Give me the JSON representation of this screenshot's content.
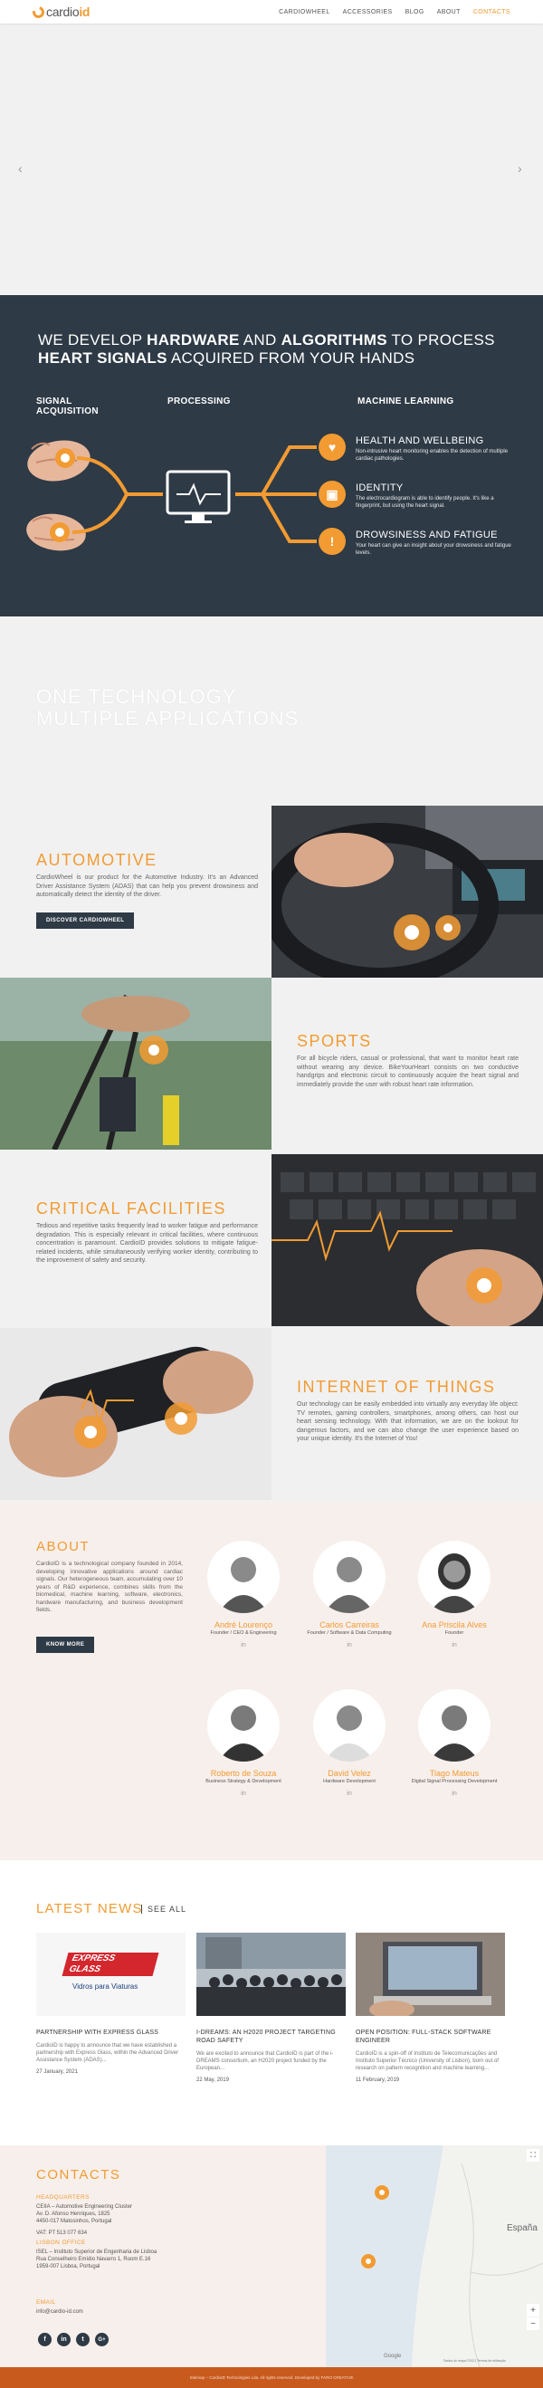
{
  "header": {
    "logo_prefix": "cardio",
    "logo_suffix": "id",
    "nav": [
      {
        "label": "CARDIOWHEEL",
        "active": false
      },
      {
        "label": "ACCESSORIES",
        "active": false
      },
      {
        "label": "BLOG",
        "active": false
      },
      {
        "label": "ABOUT",
        "active": false
      },
      {
        "label": "CONTACTS",
        "active": true
      }
    ]
  },
  "hero": {
    "prev_arrow": "‹",
    "next_arrow": "›"
  },
  "dark": {
    "headline_1": "WE DEVELOP ",
    "headline_2": "HARDWARE",
    "headline_3": " AND ",
    "headline_4": "ALGORITHMS",
    "headline_5": " TO PROCESS",
    "headline_6": "HEART SIGNALS",
    "headline_7": " ACQUIRED FROM YOUR HANDS",
    "col_signal_1": "SIGNAL",
    "col_signal_2": "ACQUISITION",
    "col_processing": "PROCESSING",
    "col_ml": "MACHINE LEARNING",
    "features": [
      {
        "title": "HEALTH AND WELLBEING",
        "text": "Non-intrusive heart monitoring enables the detection of multiple cardiac pathologies.",
        "icon": "heartbeat-icon"
      },
      {
        "title": "IDENTITY",
        "text": "The electrocardiogram is able to identify people. It's like a fingerprint, but using the heart signal.",
        "icon": "lock-icon"
      },
      {
        "title": "DROWSINESS AND FATIGUE",
        "text": "Your heart can give an insight about your drowsiness and fatigue levels.",
        "icon": "warning-icon"
      }
    ]
  },
  "tech": {
    "line1": "ONE TECHNOLOGY",
    "line2": "MULTIPLE APPLICATIONS"
  },
  "sections": {
    "automotive": {
      "title": "AUTOMOTIVE",
      "text": "CardioWheel is our product for the Automotive Industry. It's an Advanced Driver Assistance System (ADAS) that can help you prevent drowsiness and automatically detect the identity of the driver.",
      "button": "DISCOVER CARDIOWHEEL"
    },
    "sports": {
      "title": "SPORTS",
      "text": "For all bicycle riders, casual or professional, that want to monitor heart rate without wearing any device. BikeYourHeart consists on two conductive handgrips and electronic circuit to continuously acquire the heart signal and immediately provide the user with robust heart rate information."
    },
    "critical": {
      "title": "CRITICAL FACILITIES",
      "text": "Tedious and repetitive tasks frequently lead to worker fatigue and performance degradation. This is especially relevant in critical facilities, where continuous concentration is paramount. CardioID provides solutions to mitigate fatigue-related incidents, while simultaneously verifying worker identity, contributing to the improvement of safety and security."
    },
    "iot": {
      "title": "INTERNET OF THINGS",
      "text": "Our technology can be easily embedded into virtually any everyday life object: TV remotes, gaming controllers, smartphones, among others, can host our heart sensing technology. With that information, we are on the lookout for dangerous factors, and we can also change the user experience based on your unique identity. It's the Internet of You!"
    }
  },
  "about": {
    "title": "ABOUT",
    "text": "CardioID is a technological company founded in 2014, developing innovative applications around cardiac signals. Our heterogeneous team, accumulating over 10 years of R&D experience, combines skills from the biomedical, machine learning, software, electronics, hardware manufacturing, and business development fields.",
    "button": "KNOW MORE",
    "team": [
      {
        "name": "André Lourenço",
        "role": "Founder / CEO & Engineering"
      },
      {
        "name": "Carlos Carreiras",
        "role": "Founder / Software & Data Computing"
      },
      {
        "name": "Ana Priscila Alves",
        "role": "Founder"
      },
      {
        "name": "Roberto de Souza",
        "role": "Business Strategy & Development"
      },
      {
        "name": "David Velez",
        "role": "Hardware Development"
      },
      {
        "name": "Tiago Mateus",
        "role": "Digital Signal Processing Development"
      }
    ],
    "linkedin": "in"
  },
  "news": {
    "title": "LATEST NEWS",
    "see_all": "SEE ALL",
    "items": [
      {
        "title": "PARTNERSHIP WITH EXPRESS GLASS",
        "text": "CardioID is happy to announce that we have established a partnership with Express Glass, within the Advanced Driver Assistance System (ADAS)...",
        "date": "27 January, 2021",
        "logo_1": "EXPRESS",
        "logo_2": "GLASS",
        "logo_3": "Vidros para Viaturas"
      },
      {
        "title": "I-DREAMS: AN H2020 PROJECT TARGETING ROAD SAFETY",
        "text": "We are excited to announce that CardioID is part of the i-DREAMS consortium, an H2020 project funded by the European...",
        "date": "22 May, 2019"
      },
      {
        "title": "OPEN POSITION: FULL-STACK SOFTWARE ENGINEER",
        "text": "CardioID is a spin-off of Instituto de Telecomunicações and Instituto Superior Técnico (University of Lisbon), born out of research on pattern recognition and machine learning...",
        "date": "11 February, 2019"
      }
    ]
  },
  "contacts": {
    "title": "CONTACTS",
    "hq_label": "HEADQUARTERS",
    "hq_lines": [
      "CEIIA – Automotive Engineering Cluster",
      "Av. D. Afonso Henriques, 1825",
      "4450-017 Matosinhos, Portugal"
    ],
    "vat": "VAT: PT 513 077 634",
    "lisbon_label": "LISBON OFFICE",
    "lisbon_lines": [
      "ISEL – Instituto Superior de Engenharia de Lisboa",
      "Rua Conselheiro Emídio Navarro 1, Room E.16",
      "1959-007 Lisboa, Portugal"
    ],
    "email_label": "EMAIL",
    "email": "info@cardio-id.com",
    "social": [
      "f",
      "in",
      "t",
      "G+"
    ],
    "map_country": "España",
    "map_plus": "+",
    "map_minus": "−",
    "map_google": "Google",
    "map_attrib": "Dados do mapa ©2021  Termos de utilização"
  },
  "footer": {
    "text": "Sitemap – CardioID Technologies Lda. All rights reserved. Developed by FARO CREATIVE"
  },
  "colors": {
    "accent": "#f29b32",
    "dark": "#2e3a46",
    "footer": "#c95a1e"
  }
}
